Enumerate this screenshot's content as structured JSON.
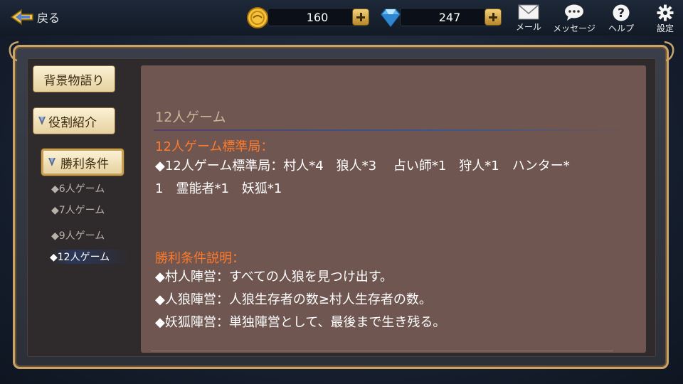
{
  "header": {
    "back_label": "戻る",
    "gold": "160",
    "gems": "247",
    "mail_label": "メール",
    "message_label": "メッセージ",
    "help_label": "ヘルプ",
    "settings_label": "設定"
  },
  "sidebar": {
    "background_story": "背景物語り",
    "role_intro": "役割紹介",
    "win_conditions": "勝利条件",
    "sub_items": [
      "◆6人ゲーム",
      "◆7人ゲーム",
      "◆9人ゲーム",
      "◆12人ゲーム"
    ],
    "active_sub": "◆12人ゲーム"
  },
  "content": {
    "title": "12人ゲーム",
    "section1_heading": "12人ゲーム標準局：",
    "section1_line1": "◆12人ゲーム標準局：村人*4　狼人*3　 占い師*1　狩人*1　ハンター*",
    "section1_line2": "1　霊能者*1　妖狐*1",
    "section2_heading": "勝利条件説明：",
    "rules": [
      "◆村人陣営：すべての人狼を見つけ出す。",
      "◆人狼陣営：人狼生存者の数≥村人生存者の数。",
      "◆妖狐陣営：単独陣営として、最後まで生き残る。"
    ]
  },
  "colors": {
    "accent_orange": "#ff7a2a",
    "panel": "#6f5651",
    "gold_frame": "#c9a46a"
  }
}
